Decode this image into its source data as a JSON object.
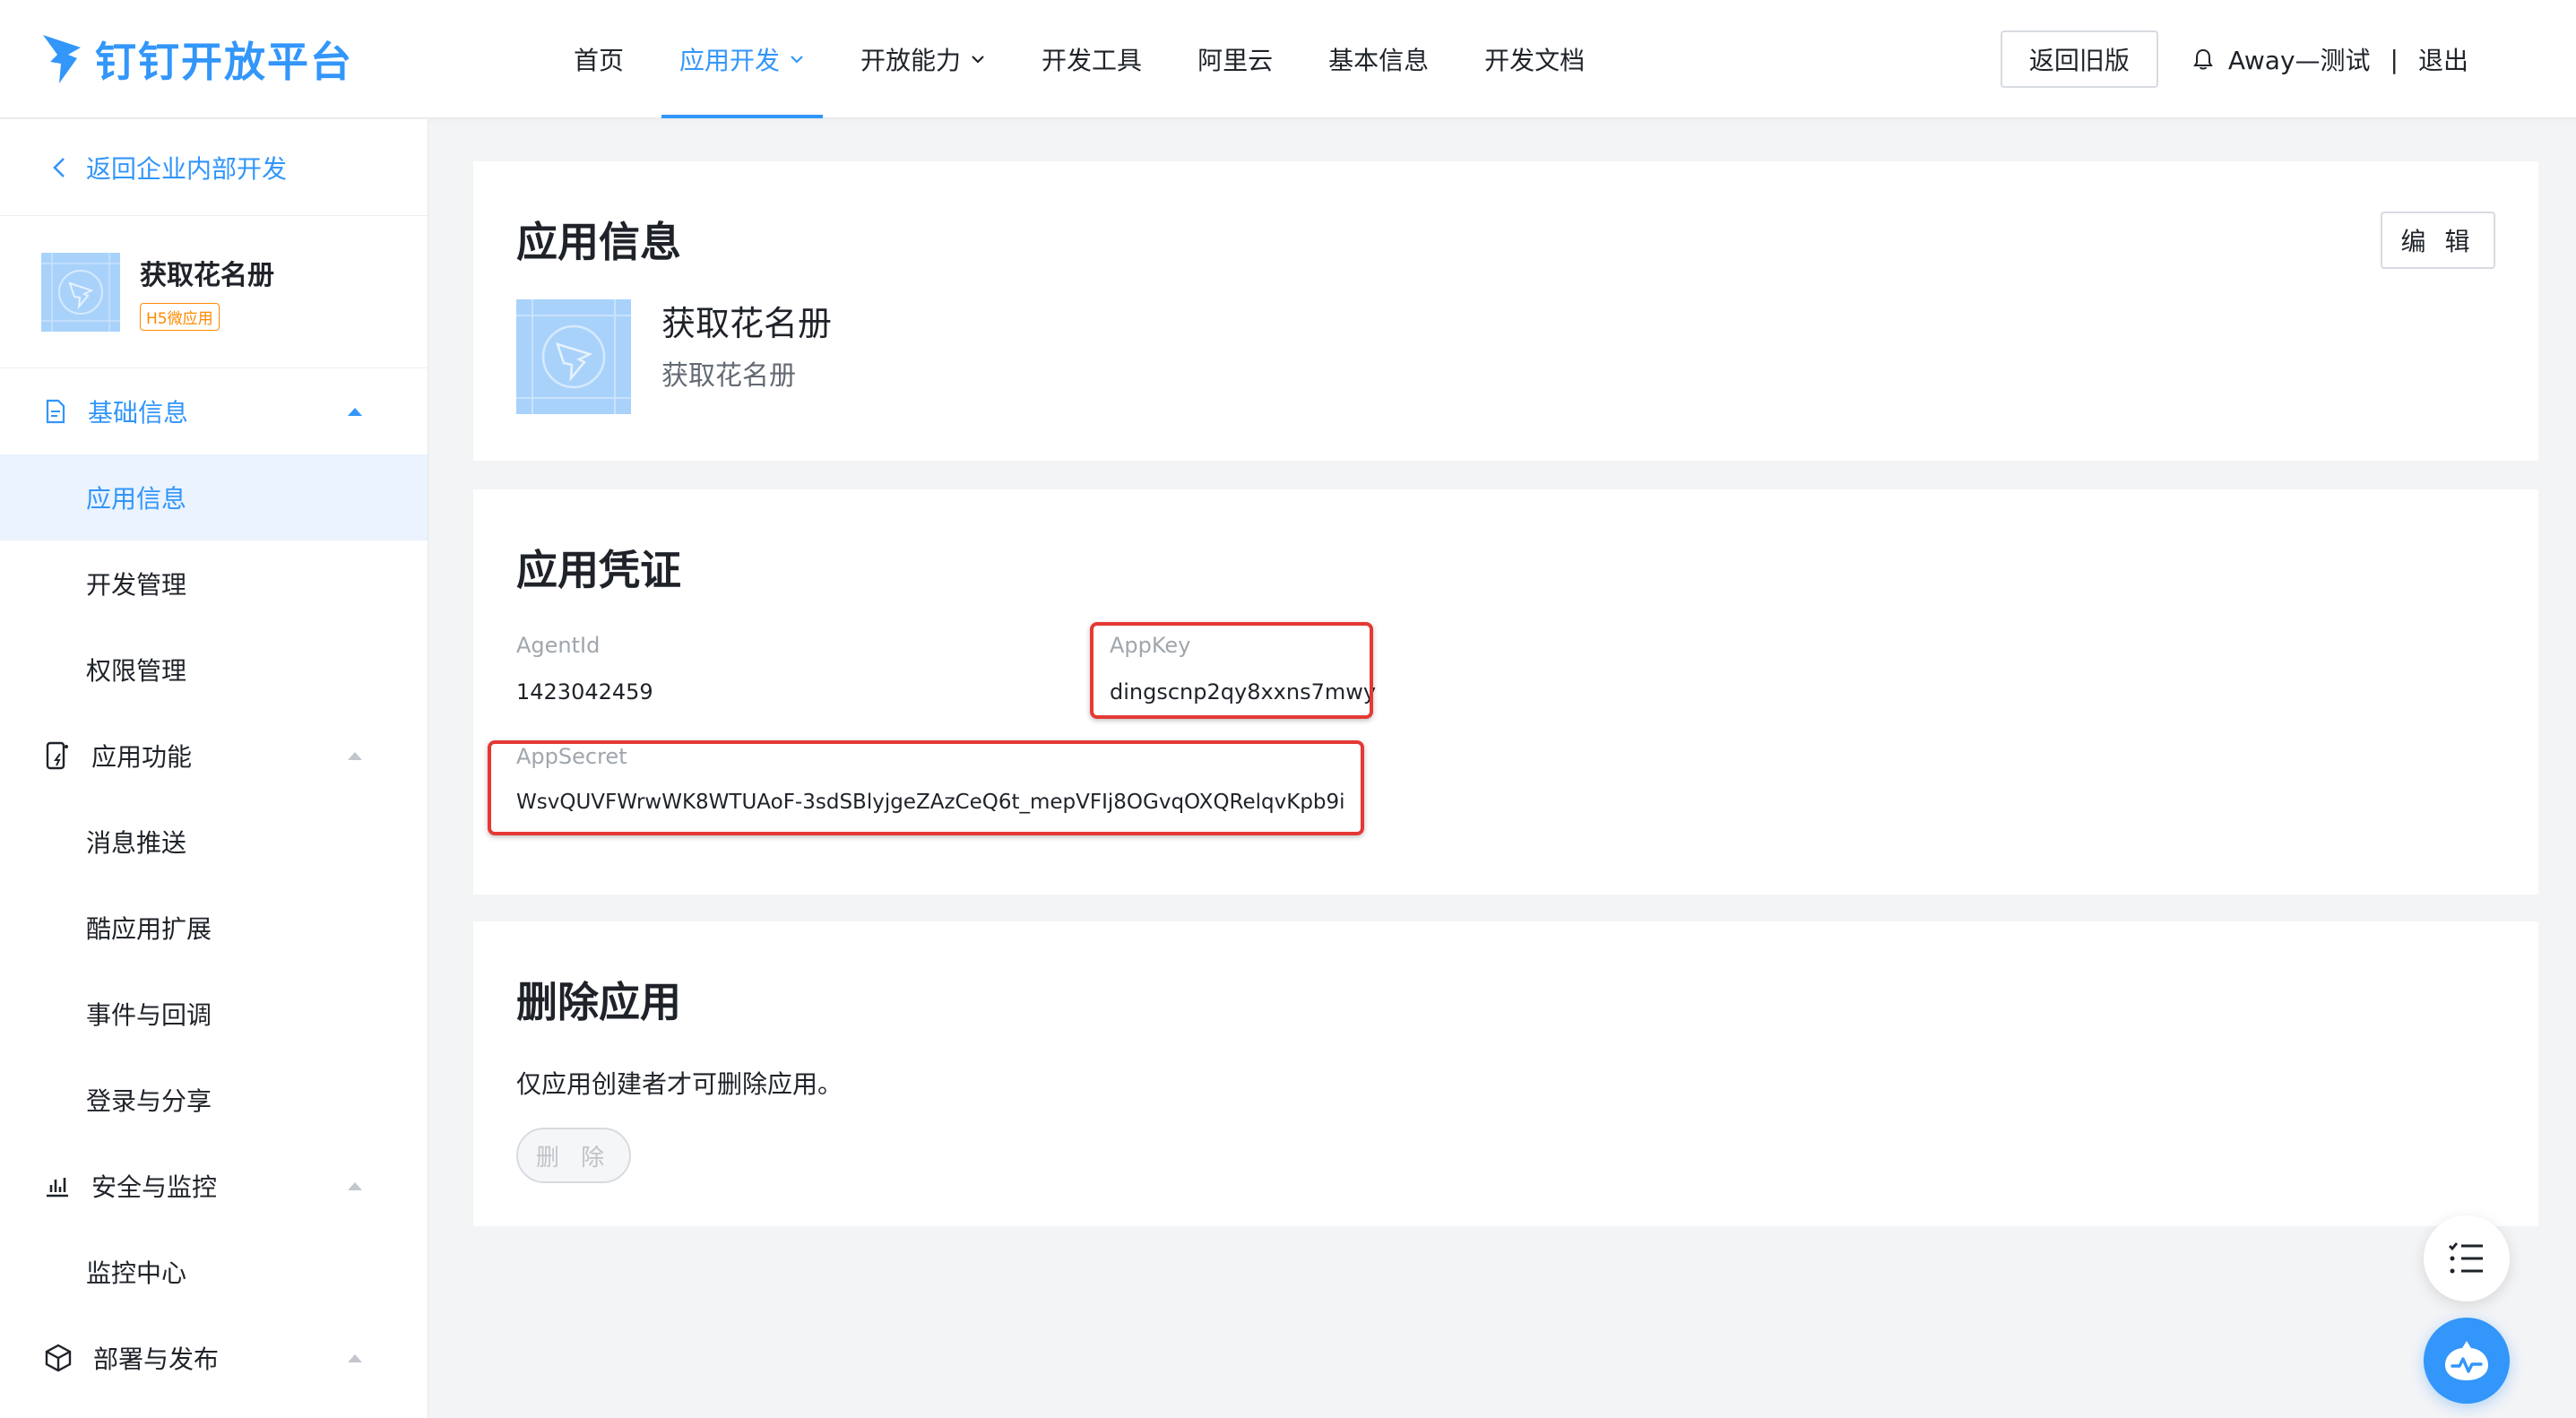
{
  "header": {
    "logo_text": "钉钉开放平台",
    "nav": [
      {
        "label": "首页",
        "active": false,
        "has_dropdown": false
      },
      {
        "label": "应用开发",
        "active": true,
        "has_dropdown": true
      },
      {
        "label": "开放能力",
        "active": false,
        "has_dropdown": true
      },
      {
        "label": "开发工具",
        "active": false,
        "has_dropdown": false
      },
      {
        "label": "阿里云",
        "active": false,
        "has_dropdown": false
      },
      {
        "label": "基本信息",
        "active": false,
        "has_dropdown": false
      },
      {
        "label": "开发文档",
        "active": false,
        "has_dropdown": false
      }
    ],
    "old_version_label": "返回旧版",
    "user_name": "Away—测试",
    "separator": "|",
    "logout_label": "退出",
    "accent_color": "#3296fa"
  },
  "sidebar": {
    "back_label": "返回企业内部开发",
    "app": {
      "name": "获取花名册",
      "badge": "H5微应用"
    },
    "groups": [
      {
        "label": "基础信息",
        "icon": "document-icon",
        "open": true,
        "items": [
          {
            "label": "应用信息",
            "active": true
          },
          {
            "label": "开发管理",
            "active": false
          },
          {
            "label": "权限管理",
            "active": false
          }
        ]
      },
      {
        "label": "应用功能",
        "icon": "app-feature-icon",
        "open": false,
        "items": [
          {
            "label": "消息推送",
            "active": false
          },
          {
            "label": "酷应用扩展",
            "active": false
          },
          {
            "label": "事件与回调",
            "active": false
          },
          {
            "label": "登录与分享",
            "active": false
          }
        ]
      },
      {
        "label": "安全与监控",
        "icon": "bar-chart-icon",
        "open": false,
        "items": [
          {
            "label": "监控中心",
            "active": false
          }
        ]
      },
      {
        "label": "部署与发布",
        "icon": "cube-icon",
        "open": false,
        "items": []
      }
    ]
  },
  "app_info": {
    "title": "应用信息",
    "edit_label": "编 辑",
    "app_name": "获取花名册",
    "app_desc": "获取花名册"
  },
  "credentials": {
    "title": "应用凭证",
    "agent_id_label": "AgentId",
    "agent_id": "1423042459",
    "app_key_label": "AppKey",
    "app_key": "dingscnp2qy8xxns7mwy",
    "app_secret_label": "AppSecret",
    "app_secret": "WsvQUVFWrwWK8WTUAoF-3sdSBlyjgeZAzCeQ6t_mepVFIj8OGvqOXQRelqvKpb9i",
    "highlight_color": "#e53935"
  },
  "delete_app": {
    "title": "删除应用",
    "note": "仅应用创建者才可删除应用。",
    "button_label": "删 除"
  },
  "floating": {
    "list_icon": "list-icon",
    "bot_icon": "dingtalk-bot-icon"
  }
}
